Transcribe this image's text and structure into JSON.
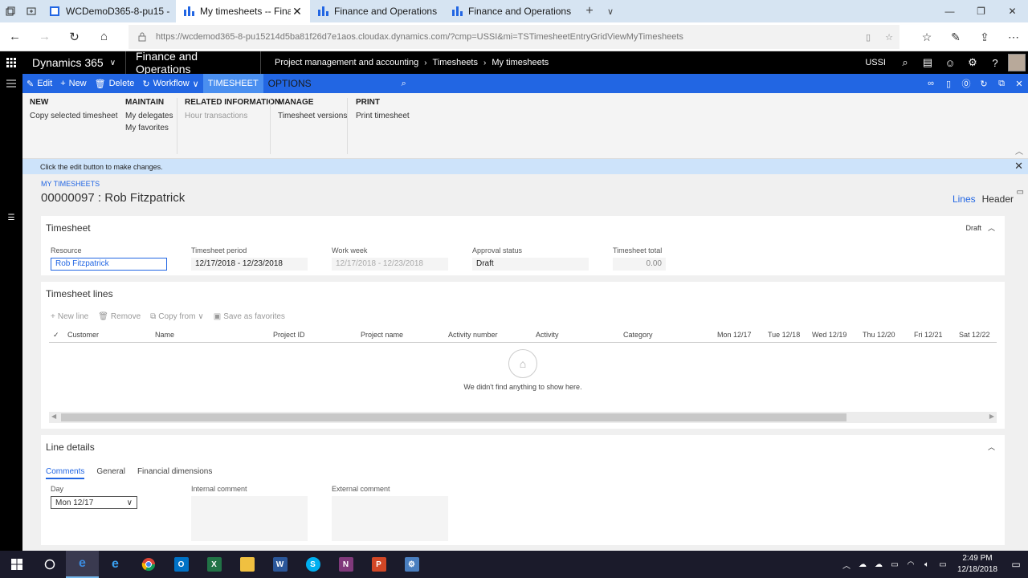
{
  "browser": {
    "tabs": [
      {
        "label": "WCDemoD365-8-pu15 -- M",
        "active": false
      },
      {
        "label": "My timesheets -- Financ",
        "active": true
      },
      {
        "label": "Finance and Operations",
        "active": false
      },
      {
        "label": "Finance and Operations",
        "active": false
      }
    ],
    "url": "https://wcdemod365-8-pu15214d5ba81f26d7e1aos.cloudax.dynamics.com/?cmp=USSI&mi=TSTimesheetEntryGridViewMyTimesheets"
  },
  "topbar": {
    "brand": "Dynamics 365",
    "app": "Finance and Operations",
    "breadcrumb": [
      "Project management and accounting",
      "Timesheets",
      "My timesheets"
    ],
    "company": "USSI"
  },
  "actionpane": {
    "edit": "Edit",
    "new": "New",
    "delete": "Delete",
    "workflow": "Workflow",
    "tab_timesheet": "TIMESHEET",
    "tab_options": "OPTIONS"
  },
  "ribbon": {
    "new": {
      "title": "NEW",
      "items": [
        "Copy selected timesheet"
      ]
    },
    "maintain": {
      "title": "MAINTAIN",
      "items": [
        "My delegates",
        "My favorites"
      ]
    },
    "related": {
      "title": "RELATED INFORMATION",
      "items": [
        "Hour transactions"
      ]
    },
    "manage": {
      "title": "MANAGE",
      "items": [
        "Timesheet versions"
      ]
    },
    "print": {
      "title": "PRINT",
      "items": [
        "Print timesheet"
      ]
    }
  },
  "message": "Click the edit button to make changes.",
  "page": {
    "caption": "MY TIMESHEETS",
    "title": "00000097 : Rob Fitzpatrick",
    "view_lines": "Lines",
    "view_header": "Header"
  },
  "timesheet": {
    "section_title": "Timesheet",
    "status": "Draft",
    "fields": {
      "resource_label": "Resource",
      "resource_value": "Rob Fitzpatrick",
      "period_label": "Timesheet period",
      "period_value": "12/17/2018 - 12/23/2018",
      "week_label": "Work week",
      "week_value": "12/17/2018 - 12/23/2018",
      "approval_label": "Approval status",
      "approval_value": "Draft",
      "total_label": "Timesheet total",
      "total_value": "0.00"
    }
  },
  "lines": {
    "section_title": "Timesheet lines",
    "toolbar": {
      "new_line": "New line",
      "remove": "Remove",
      "copy_from": "Copy from",
      "save_favorites": "Save as favorites"
    },
    "columns": [
      "Customer",
      "Name",
      "Project ID",
      "Project name",
      "Activity number",
      "Activity",
      "Category",
      "Mon 12/17",
      "Tue 12/18",
      "Wed 12/19",
      "Thu 12/20",
      "Fri 12/21",
      "Sat 12/22"
    ],
    "empty_message": "We didn't find anything to show here."
  },
  "line_details": {
    "section_title": "Line details",
    "tabs": [
      "Comments",
      "General",
      "Financial dimensions"
    ],
    "day_label": "Day",
    "day_value": "Mon 12/17",
    "internal_label": "Internal comment",
    "external_label": "External comment"
  },
  "taskbar": {
    "time": "2:49 PM",
    "date": "12/18/2018"
  },
  "colors": {
    "accent": "#2266e3",
    "topbar": "#000000",
    "message": "#cde3fa"
  }
}
